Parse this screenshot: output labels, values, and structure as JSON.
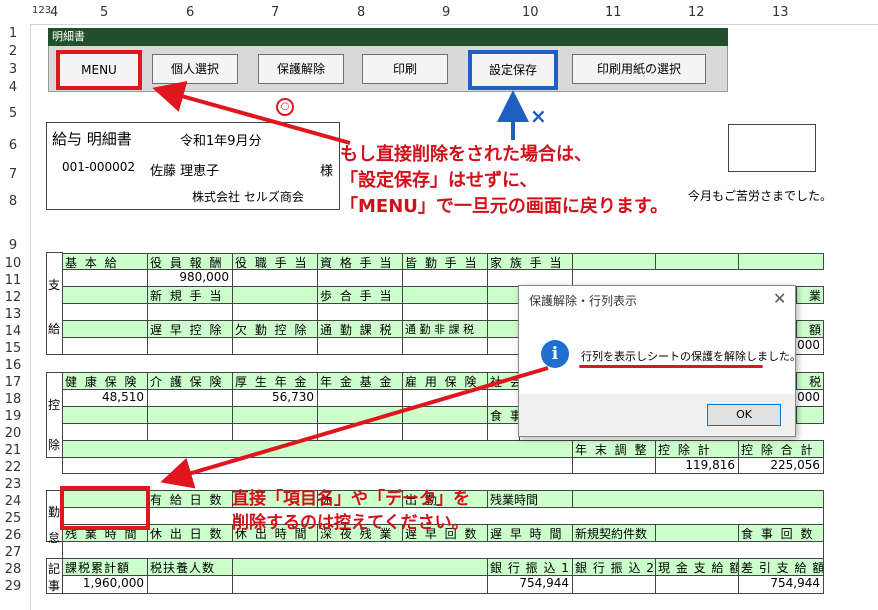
{
  "col_headers": [
    "1",
    "2",
    "3",
    "4",
    "5",
    "6",
    "7",
    "8",
    "9",
    "10",
    "11",
    "12",
    "13"
  ],
  "row_headers": [
    "1",
    "2",
    "3",
    "4",
    "5",
    "6",
    "7",
    "8",
    "9",
    "10",
    "11",
    "12",
    "13",
    "14",
    "15",
    "16",
    "17",
    "18",
    "19",
    "20",
    "21",
    "22",
    "23",
    "24",
    "25",
    "26",
    "27",
    "28",
    "29"
  ],
  "toolbar": {
    "title": "明細書",
    "buttons": [
      "MENU",
      "個人選択",
      "保護解除",
      "印刷",
      "設定保存",
      "印刷用紙の選択"
    ]
  },
  "payslip": {
    "title": "給与 明細書",
    "period": "令和1年9月分",
    "employee_id": "001-000002",
    "employee_name": "佐藤 理恵子",
    "honorific": "様",
    "company": "株式会社 セルズ商会",
    "thanks": "今月もご苦労さまでした。"
  },
  "section_labels": {
    "shikyu1": "支",
    "shikyu2": "給",
    "kojo1": "控",
    "kojo2": "除",
    "kintai1": "勤",
    "kintai2": "怠",
    "kiroku1": "記",
    "kiroku2": "事"
  },
  "pay": {
    "headers1": [
      "基 本 給",
      "役 員 報 酬",
      "役 職 手 当",
      "資 格 手 当",
      "皆 勤 手 当",
      "家 族 手 当"
    ],
    "values1": [
      "",
      "980,000",
      "",
      "",
      "",
      ""
    ],
    "headers2": [
      "",
      "新 規 手 当",
      "",
      "歩 合 手 当",
      "",
      ""
    ],
    "headers3": [
      "",
      "遅 早 控 除",
      "欠 勤 控 除",
      "通 勤 課 税",
      "通 勤 非 課 税",
      ""
    ],
    "right_partial_1": "業",
    "right_partial_2": "額",
    "right_partial_3": ",000"
  },
  "deduct": {
    "headers1": [
      "健 康 保 険",
      "介 護 保 険",
      "厚 生 年 金",
      "年 金 基 金",
      "雇 用 保 険",
      "社 会"
    ],
    "values1": [
      "48,510",
      "",
      "56,730",
      "",
      "",
      ""
    ],
    "row3_label": "食 事",
    "right_partial_1": "税",
    "right_partial_2": ",000",
    "bottom_headers": [
      "年 末 調 整",
      "控 除 計",
      "控 除 合 計"
    ],
    "bottom_values": [
      "",
      "119,816",
      "225,056"
    ]
  },
  "attend": {
    "headers1": [
      "",
      "有 給 日 数",
      "",
      "休",
      "暇",
      "出 勤",
      "残業時間"
    ],
    "headers2": [
      "残 業 時 間",
      "休 出 日 数",
      "休 出 時 間",
      "深 夜 残 業",
      "遅 早 回 数",
      "遅 早 時 間",
      "新規契約件数",
      "",
      "食 事 回 数"
    ]
  },
  "record": {
    "headers": [
      "課税累計額",
      "税扶養人数",
      "",
      "",
      "",
      "銀 行 振 込 1",
      "銀 行 振 込 2",
      "現 金 支 給 額",
      "差 引 支 給 額"
    ],
    "values": [
      "1,960,000",
      "",
      "",
      "",
      "",
      "754,944",
      "",
      "",
      "754,944"
    ]
  },
  "annotations": {
    "circle_mark": "○",
    "cross_mark": "×",
    "note1_line1": "もし直接削除をされた場合は、",
    "note1_line2": "「設定保存」はせずに、",
    "note1_line3": "「MENU」で一旦元の画面に戻ります。",
    "note2_line1": "直接「項目名」や「データ」を",
    "note2_line2": "削除するのは控えてください。"
  },
  "dialog": {
    "title": "保護解除・行列表示",
    "message": "行列を表示しシートの保護を解除しました。",
    "ok": "OK"
  },
  "colors": {
    "accent_red": "#e0161e",
    "accent_blue": "#1f5fbf",
    "cell_green": "#ccffcc",
    "toolbar_title": "#22502a"
  }
}
